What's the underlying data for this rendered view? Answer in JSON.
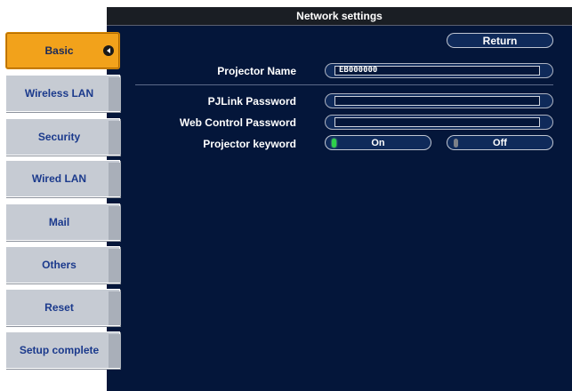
{
  "window": {
    "title": "Network settings"
  },
  "sidebar": {
    "items": [
      {
        "label": "Basic",
        "active": true
      },
      {
        "label": "Wireless LAN"
      },
      {
        "label": "Security"
      },
      {
        "label": "Wired LAN"
      },
      {
        "label": "Mail"
      },
      {
        "label": "Others"
      },
      {
        "label": "Reset"
      },
      {
        "label": "Setup complete"
      }
    ]
  },
  "header": {
    "return_label": "Return"
  },
  "form": {
    "projector_name": {
      "label": "Projector Name",
      "value": "EB000000"
    },
    "pjlink_password": {
      "label": "PJLink Password",
      "value": ""
    },
    "web_control_password": {
      "label": "Web Control Password",
      "value": ""
    },
    "projector_keyword": {
      "label": "Projector keyword",
      "options": [
        "On",
        "Off"
      ],
      "selected": "On"
    }
  },
  "colors": {
    "panel_bg": "#04163a",
    "active_tab": "#f2a21b",
    "inactive_tab": "#c6cbd3",
    "indicator_on": "#2ed14a"
  },
  "icons": {
    "active_tab_marker": "arrow-left-icon"
  }
}
